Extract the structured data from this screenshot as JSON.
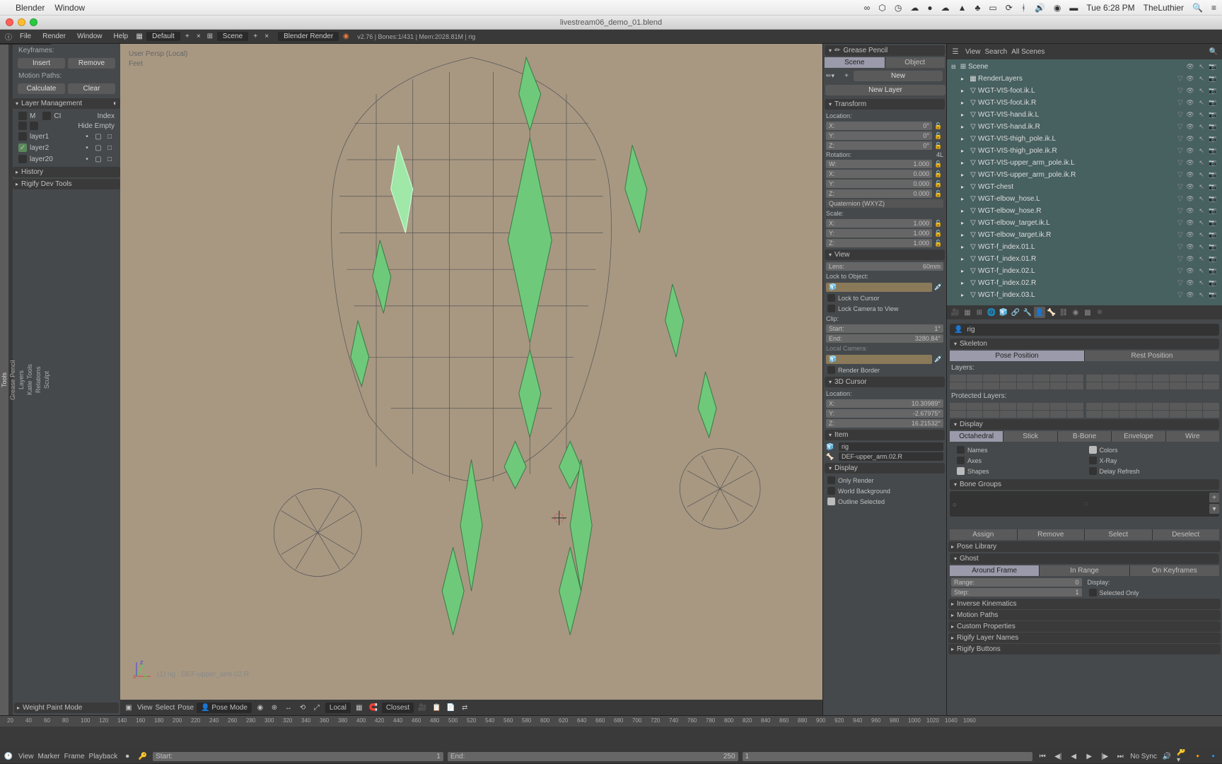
{
  "mac": {
    "app": "Blender",
    "menu": "Window",
    "time": "Tue 6:28 PM",
    "user": "TheLuthier"
  },
  "window": {
    "title": "livestream06_demo_01.blend"
  },
  "top_header": {
    "file": "File",
    "render": "Render",
    "window": "Window",
    "help": "Help",
    "layout": "Default",
    "scene": "Scene",
    "engine": "Blender Render",
    "stats": "v2.76 | Bones:1/431 | Mem:2028.81M | rig"
  },
  "left_tabs": [
    "Tools",
    "Grease Pencil",
    "Layers",
    "Katie Tools",
    "Relations",
    "Sculpt"
  ],
  "left_panel": {
    "keyframes": "Keyframes:",
    "insert": "Insert",
    "remove": "Remove",
    "motion_paths": "Motion Paths:",
    "calculate": "Calculate",
    "clear": "Clear",
    "layer_mgmt": "Layer Management",
    "m": "M",
    "ci": "CI",
    "index": "Index",
    "hide_empty": "Hide Empty",
    "layers": [
      {
        "name": "layer1",
        "on": false
      },
      {
        "name": "layer2",
        "on": true
      },
      {
        "name": "layer20",
        "on": false
      }
    ],
    "history": "History",
    "rigify": "Rigify Dev Tools",
    "weight_paint": "Weight Paint Mode"
  },
  "viewport": {
    "persp": "User Persp (Local)",
    "collection": "Feet",
    "selected": "(1) rig : DEF-upper_arm.02.R",
    "header": {
      "view": "View",
      "select": "Select",
      "pose": "Pose",
      "mode": "Pose Mode",
      "orientation": "Local",
      "snap": "Closest"
    }
  },
  "npanel": {
    "grease_pencil": "Grease Pencil",
    "scene_tab": "Scene",
    "object_tab": "Object",
    "new": "New",
    "new_layer": "New Layer",
    "transform": "Transform",
    "location": "Location:",
    "loc": {
      "x": "0°",
      "y": "0°",
      "z": "0°"
    },
    "rotation": "Rotation:",
    "rot_mode_label": "4L",
    "rot": {
      "w": "1.000",
      "x": "0.000",
      "y": "0.000",
      "z": "0.000"
    },
    "rot_mode": "Quaternion (WXYZ)",
    "scale": "Scale:",
    "scale_v": {
      "x": "1.000",
      "y": "1.000",
      "z": "1.000"
    },
    "view": "View",
    "lens": "Lens:",
    "lens_v": "60mm",
    "lock_obj": "Lock to Object:",
    "lock_cursor": "Lock to Cursor",
    "lock_cam": "Lock Camera to View",
    "clip": "Clip:",
    "clip_start": "Start:",
    "clip_start_v": "1°",
    "clip_end": "End:",
    "clip_end_v": "3280.84°",
    "local_cam": "Local Camera:",
    "render_border": "Render Border",
    "cursor3d": "3D Cursor",
    "cursor_loc": "Location:",
    "cursor": {
      "x": "10.30989°",
      "y": "-2.67975°",
      "z": "16.21532°"
    },
    "item": "Item",
    "item_name": "rig",
    "item_bone": "DEF-upper_arm.02.R",
    "display": "Display",
    "only_render": "Only Render",
    "world_bg": "World Background",
    "outline_sel": "Outline Selected"
  },
  "outliner": {
    "view": "View",
    "search": "Search",
    "filter": "All Scenes",
    "tree": [
      {
        "depth": 0,
        "icon": "⊞",
        "label": "Scene"
      },
      {
        "depth": 1,
        "icon": "▦",
        "label": "RenderLayers"
      },
      {
        "depth": 1,
        "icon": "▽",
        "label": "WGT-VIS-foot.ik.L"
      },
      {
        "depth": 1,
        "icon": "▽",
        "label": "WGT-VIS-foot.ik.R"
      },
      {
        "depth": 1,
        "icon": "▽",
        "label": "WGT-VIS-hand.ik.L"
      },
      {
        "depth": 1,
        "icon": "▽",
        "label": "WGT-VIS-hand.ik.R"
      },
      {
        "depth": 1,
        "icon": "▽",
        "label": "WGT-VIS-thigh_pole.ik.L"
      },
      {
        "depth": 1,
        "icon": "▽",
        "label": "WGT-VIS-thigh_pole.ik.R"
      },
      {
        "depth": 1,
        "icon": "▽",
        "label": "WGT-VIS-upper_arm_pole.ik.L"
      },
      {
        "depth": 1,
        "icon": "▽",
        "label": "WGT-VIS-upper_arm_pole.ik.R"
      },
      {
        "depth": 1,
        "icon": "▽",
        "label": "WGT-chest"
      },
      {
        "depth": 1,
        "icon": "▽",
        "label": "WGT-elbow_hose.L"
      },
      {
        "depth": 1,
        "icon": "▽",
        "label": "WGT-elbow_hose.R"
      },
      {
        "depth": 1,
        "icon": "▽",
        "label": "WGT-elbow_target.ik.L"
      },
      {
        "depth": 1,
        "icon": "▽",
        "label": "WGT-elbow_target.ik.R"
      },
      {
        "depth": 1,
        "icon": "▽",
        "label": "WGT-f_index.01.L"
      },
      {
        "depth": 1,
        "icon": "▽",
        "label": "WGT-f_index.01.R"
      },
      {
        "depth": 1,
        "icon": "▽",
        "label": "WGT-f_index.02.L"
      },
      {
        "depth": 1,
        "icon": "▽",
        "label": "WGT-f_index.02.R"
      },
      {
        "depth": 1,
        "icon": "▽",
        "label": "WGT-f_index.03.L"
      }
    ]
  },
  "properties": {
    "name": "rig",
    "skeleton": "Skeleton",
    "pose_pos": "Pose Position",
    "rest_pos": "Rest Position",
    "layers": "Layers:",
    "protected": "Protected Layers:",
    "display": "Display",
    "display_types": [
      "Octahedral",
      "Stick",
      "B-Bone",
      "Envelope",
      "Wire"
    ],
    "disp_names": "Names",
    "disp_colors": "Colors",
    "disp_axes": "Axes",
    "disp_xray": "X-Ray",
    "disp_shapes": "Shapes",
    "disp_delay": "Delay Refresh",
    "bone_groups": "Bone Groups",
    "assign": "Assign",
    "remove": "Remove",
    "select": "Select",
    "deselect": "Deselect",
    "pose_lib": "Pose Library",
    "ghost": "Ghost",
    "ghost_types": [
      "Around Frame",
      "In Range",
      "On Keyframes"
    ],
    "range": "Range:",
    "range_v": "0",
    "step": "Step:",
    "step_v": "1",
    "ghost_display": "Display:",
    "sel_only": "Selected Only",
    "ik": "Inverse Kinematics",
    "motion_paths": "Motion Paths",
    "custom_props": "Custom Properties",
    "rigify_layer": "Rigify Layer Names",
    "rigify_buttons": "Rigify Buttons"
  },
  "timeline": {
    "view": "View",
    "marker": "Marker",
    "frame": "Frame",
    "playback": "Playback",
    "start": "Start:",
    "start_v": "1",
    "end": "End:",
    "end_v": "250",
    "current": "1",
    "sync": "No Sync",
    "ticks": [
      "20",
      "40",
      "60",
      "80",
      "100",
      "120",
      "140",
      "160",
      "180",
      "200",
      "220",
      "240",
      "260",
      "280",
      "300",
      "320",
      "340",
      "360",
      "380",
      "400",
      "420",
      "440",
      "460",
      "480",
      "500",
      "520",
      "540",
      "560",
      "580",
      "600",
      "620",
      "640",
      "660",
      "680",
      "700",
      "720",
      "740",
      "760",
      "780",
      "800",
      "820",
      "840",
      "860",
      "880",
      "900",
      "920",
      "940",
      "960",
      "980",
      "1000",
      "1020",
      "1040",
      "1060"
    ]
  }
}
